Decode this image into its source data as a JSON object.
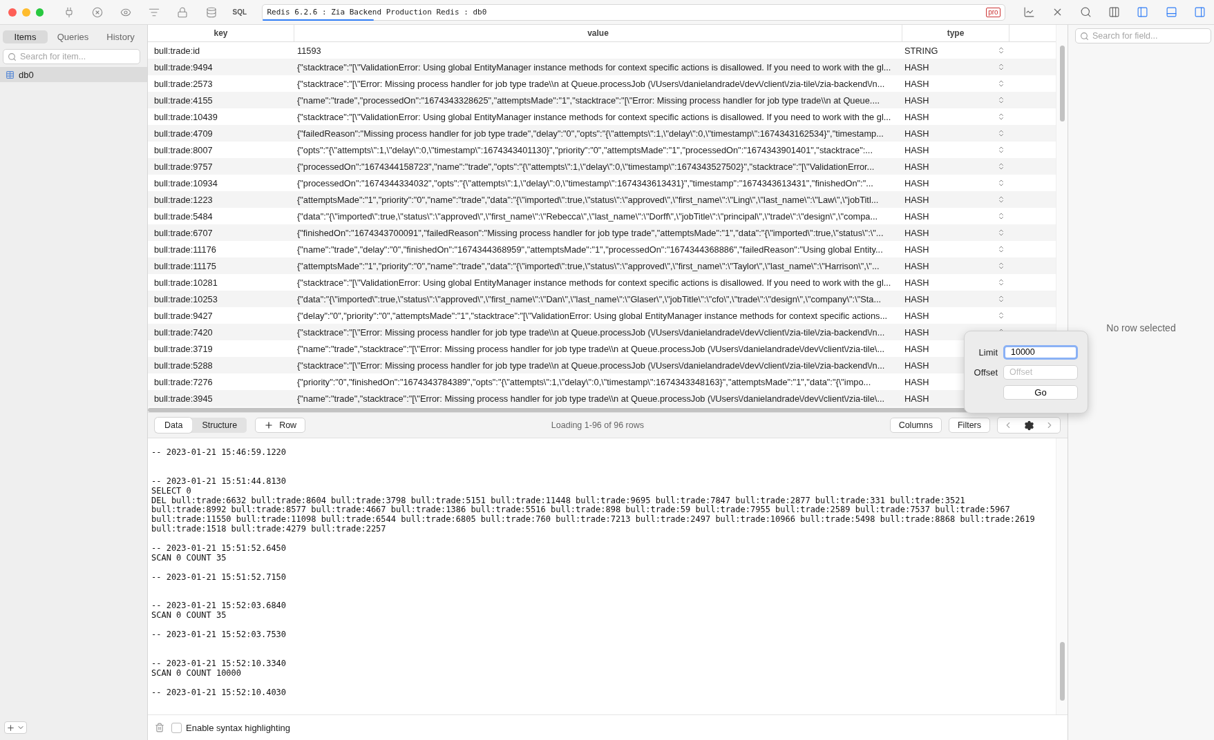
{
  "window": {
    "sql_label": "SQL",
    "address": "Redis 6.2.6 : Zia Backend Production Redis : db0",
    "badge": "pro",
    "progress": {
      "level": 0.15
    }
  },
  "sidebar": {
    "tabs": [
      {
        "label": "Items",
        "selected": true
      },
      {
        "label": "Queries",
        "selected": false
      },
      {
        "label": "History",
        "selected": false
      }
    ],
    "search": {
      "placeholder": "Search for item..."
    },
    "items": [
      {
        "label": "db0",
        "selected": true
      }
    ]
  },
  "table": {
    "columns": [
      "key",
      "value",
      "type"
    ],
    "rows": [
      {
        "key": "bull:trade:id",
        "value": "11593",
        "type": "STRING"
      },
      {
        "key": "bull:trade:9494",
        "value": "{\"stacktrace\":\"[\\\"ValidationError: Using global EntityManager instance methods for context specific actions is disallowed. If you need to work with the gl...",
        "type": "HASH"
      },
      {
        "key": "bull:trade:2573",
        "value": "{\"stacktrace\":\"[\\\"Error: Missing process handler for job type trade\\\\n    at Queue.processJob (\\/Users\\/danielandrade\\/dev\\/client\\/zia-tile\\/zia-backend\\/n...",
        "type": "HASH"
      },
      {
        "key": "bull:trade:4155",
        "value": "{\"name\":\"trade\",\"processedOn\":\"1674343328625\",\"attemptsMade\":\"1\",\"stacktrace\":\"[\\\"Error: Missing process handler for job type trade\\\\n    at Queue....",
        "type": "HASH"
      },
      {
        "key": "bull:trade:10439",
        "value": "{\"stacktrace\":\"[\\\"ValidationError: Using global EntityManager instance methods for context specific actions is disallowed. If you need to work with the gl...",
        "type": "HASH"
      },
      {
        "key": "bull:trade:4709",
        "value": "{\"failedReason\":\"Missing process handler for job type trade\",\"delay\":\"0\",\"opts\":\"{\\\"attempts\\\":1,\\\"delay\\\":0,\\\"timestamp\\\":1674343162534}\",\"timestamp...",
        "type": "HASH"
      },
      {
        "key": "bull:trade:8007",
        "value": "{\"opts\":\"{\\\"attempts\\\":1,\\\"delay\\\":0,\\\"timestamp\\\":1674343401130}\",\"priority\":\"0\",\"attemptsMade\":\"1\",\"processedOn\":\"1674343901401\",\"stacktrace\":...",
        "type": "HASH"
      },
      {
        "key": "bull:trade:9757",
        "value": "{\"processedOn\":\"1674344158723\",\"name\":\"trade\",\"opts\":\"{\\\"attempts\\\":1,\\\"delay\\\":0,\\\"timestamp\\\":1674343527502}\",\"stacktrace\":\"[\\\"ValidationError...",
        "type": "HASH"
      },
      {
        "key": "bull:trade:10934",
        "value": "{\"processedOn\":\"1674344334032\",\"opts\":\"{\\\"attempts\\\":1,\\\"delay\\\":0,\\\"timestamp\\\":1674343613431}\",\"timestamp\":\"1674343613431\",\"finishedOn\":\"...",
        "type": "HASH"
      },
      {
        "key": "bull:trade:1223",
        "value": "{\"attemptsMade\":\"1\",\"priority\":\"0\",\"name\":\"trade\",\"data\":\"{\\\"imported\\\":true,\\\"status\\\":\\\"approved\\\",\\\"first_name\\\":\\\"Ling\\\",\\\"last_name\\\":\\\"Law\\\",\\\"jobTitl...",
        "type": "HASH"
      },
      {
        "key": "bull:trade:5484",
        "value": "{\"data\":\"{\\\"imported\\\":true,\\\"status\\\":\\\"approved\\\",\\\"first_name\\\":\\\"Rebecca\\\",\\\"last_name\\\":\\\"Dorff\\\",\\\"jobTitle\\\":\\\"principal\\\",\\\"trade\\\":\\\"design\\\",\\\"compa...",
        "type": "HASH"
      },
      {
        "key": "bull:trade:6707",
        "value": "{\"finishedOn\":\"1674343700091\",\"failedReason\":\"Missing process handler for job type trade\",\"attemptsMade\":\"1\",\"data\":\"{\\\"imported\\\":true,\\\"status\\\":\\\"...",
        "type": "HASH"
      },
      {
        "key": "bull:trade:11176",
        "value": "{\"name\":\"trade\",\"delay\":\"0\",\"finishedOn\":\"1674344368959\",\"attemptsMade\":\"1\",\"processedOn\":\"1674344368886\",\"failedReason\":\"Using global Entity...",
        "type": "HASH"
      },
      {
        "key": "bull:trade:11175",
        "value": "{\"attemptsMade\":\"1\",\"priority\":\"0\",\"name\":\"trade\",\"data\":\"{\\\"imported\\\":true,\\\"status\\\":\\\"approved\\\",\\\"first_name\\\":\\\"Taylor\\\",\\\"last_name\\\":\\\"Harrison\\\",\\\"...",
        "type": "HASH"
      },
      {
        "key": "bull:trade:10281",
        "value": "{\"stacktrace\":\"[\\\"ValidationError: Using global EntityManager instance methods for context specific actions is disallowed. If you need to work with the gl...",
        "type": "HASH"
      },
      {
        "key": "bull:trade:10253",
        "value": "{\"data\":\"{\\\"imported\\\":true,\\\"status\\\":\\\"approved\\\",\\\"first_name\\\":\\\"Dan\\\",\\\"last_name\\\":\\\"Glaser\\\",\\\"jobTitle\\\":\\\"cfo\\\",\\\"trade\\\":\\\"design\\\",\\\"company\\\":\\\"Sta...",
        "type": "HASH"
      },
      {
        "key": "bull:trade:9427",
        "value": "{\"delay\":\"0\",\"priority\":\"0\",\"attemptsMade\":\"1\",\"stacktrace\":\"[\\\"ValidationError: Using global EntityManager instance methods for context specific actions...",
        "type": "HASH"
      },
      {
        "key": "bull:trade:7420",
        "value": "{\"stacktrace\":\"[\\\"Error: Missing process handler for job type trade\\\\n    at Queue.processJob (\\/Users\\/danielandrade\\/dev\\/client\\/zia-tile\\/zia-backend\\/n...",
        "type": "HASH"
      },
      {
        "key": "bull:trade:3719",
        "value": "{\"name\":\"trade\",\"stacktrace\":\"[\\\"Error: Missing process handler for job type trade\\\\n    at Queue.processJob (\\/Users\\/danielandrade\\/dev\\/client\\/zia-tile\\...",
        "type": "HASH"
      },
      {
        "key": "bull:trade:5288",
        "value": "{\"stacktrace\":\"[\\\"Error: Missing process handler for job type trade\\\\n    at Queue.processJob (\\/Users\\/danielandrade\\/dev\\/client\\/zia-tile\\/zia-backend\\/n...",
        "type": "HASH"
      },
      {
        "key": "bull:trade:7276",
        "value": "{\"priority\":\"0\",\"finishedOn\":\"1674343784389\",\"opts\":\"{\\\"attempts\\\":1,\\\"delay\\\":0,\\\"timestamp\\\":1674343348163}\",\"attemptsMade\":\"1\",\"data\":\"{\\\"impo...",
        "type": "HASH"
      },
      {
        "key": "bull:trade:3945",
        "value": "{\"name\":\"trade\",\"stacktrace\":\"[\\\"Error: Missing process handler for job type trade\\\\n    at Queue.processJob (\\/Users\\/danielandrade\\/dev\\/client\\/zia-tile\\...",
        "type": "HASH"
      }
    ]
  },
  "data_bar": {
    "tabs": [
      {
        "label": "Data",
        "selected": true
      },
      {
        "label": "Structure",
        "selected": false
      }
    ],
    "add_row": "Row",
    "status": "Loading 1-96 of 96 rows",
    "buttons": [
      "Columns",
      "Filters"
    ]
  },
  "popover": {
    "limit_label": "Limit",
    "limit_value": "10000",
    "offset_label": "Offset",
    "offset_placeholder": "Offset",
    "go": "Go"
  },
  "log": [
    {
      "time": "-- 2023-01-21 15:46:59.1220"
    },
    {
      "time": "-- 2023-01-21 15:51:44.8130",
      "commands": [
        "SELECT 0",
        "DEL bull:trade:6632 bull:trade:8604 bull:trade:3798 bull:trade:5151 bull:trade:11448 bull:trade:9695 bull:trade:7847 bull:trade:2877 bull:trade:331 bull:trade:3521",
        "bull:trade:8992 bull:trade:8577 bull:trade:4667 bull:trade:1386 bull:trade:5516 bull:trade:898 bull:trade:59 bull:trade:7955 bull:trade:2589 bull:trade:7537 bull:trade:5967",
        "bull:trade:11550 bull:trade:11098 bull:trade:6544 bull:trade:6805 bull:trade:760 bull:trade:7213 bull:trade:2497 bull:trade:10966 bull:trade:5498 bull:trade:8868 bull:trade:2619",
        "bull:trade:1518 bull:trade:4279 bull:trade:2257"
      ]
    },
    {
      "time": "-- 2023-01-21 15:51:52.6450",
      "commands": [
        "SCAN 0 COUNT 35"
      ]
    },
    {
      "time": "-- 2023-01-21 15:51:52.7150"
    },
    {
      "time": "-- 2023-01-21 15:52:03.6840",
      "commands": [
        "SCAN 0 COUNT 35"
      ]
    },
    {
      "time": "-- 2023-01-21 15:52:03.7530"
    },
    {
      "time": "-- 2023-01-21 15:52:10.3340",
      "commands": [
        "SCAN 0 COUNT 10000"
      ]
    },
    {
      "time": "-- 2023-01-21 15:52:10.4030"
    }
  ],
  "footer": {
    "checkbox": {
      "label": "Enable syntax highlighting",
      "checked": false
    }
  },
  "detail": {
    "search": {
      "placeholder": "Search for field..."
    },
    "empty": "No row selected"
  }
}
